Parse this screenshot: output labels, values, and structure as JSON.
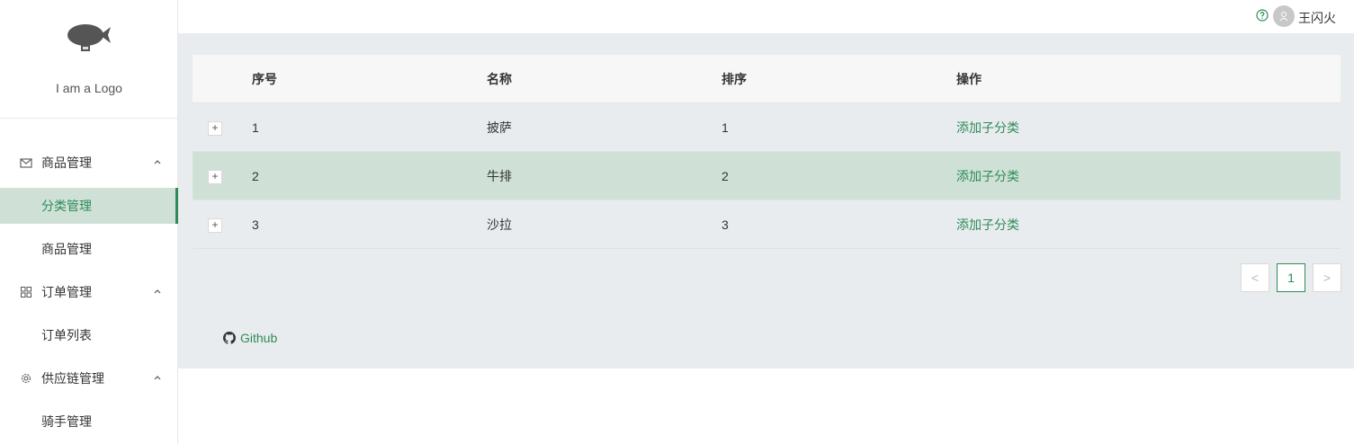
{
  "logo": {
    "text": "I am a Logo"
  },
  "header": {
    "username": "王闪火"
  },
  "menu": {
    "groups": [
      {
        "title": "商品管理",
        "icon": "mail-icon",
        "items": [
          "分类管理",
          "商品管理"
        ]
      },
      {
        "title": "订单管理",
        "icon": "appstore-icon",
        "items": [
          "订单列表"
        ]
      },
      {
        "title": "供应链管理",
        "icon": "gear-icon",
        "items": [
          "骑手管理"
        ]
      }
    ],
    "active": "分类管理"
  },
  "table": {
    "headers": [
      "序号",
      "名称",
      "排序",
      "操作"
    ],
    "rows": [
      {
        "index": "1",
        "name": "披萨",
        "sort": "1",
        "action": "添加子分类"
      },
      {
        "index": "2",
        "name": "牛排",
        "sort": "2",
        "action": "添加子分类"
      },
      {
        "index": "3",
        "name": "沙拉",
        "sort": "3",
        "action": "添加子分类"
      }
    ],
    "expand_symbol": "+"
  },
  "pagination": {
    "prev": "<",
    "current": "1",
    "next": ">"
  },
  "footer": {
    "github": "Github"
  },
  "colors": {
    "accent": "#2e8b57",
    "highlight_row": "#cfe1d7",
    "main_bg": "#e9ecef"
  }
}
